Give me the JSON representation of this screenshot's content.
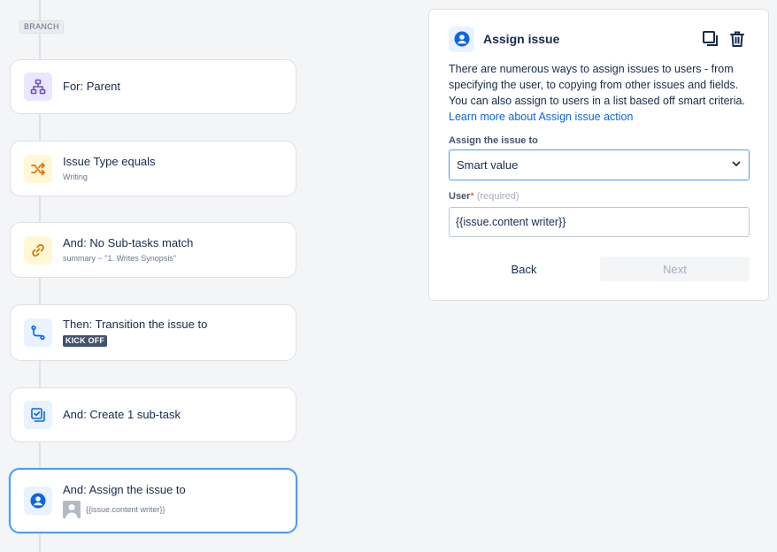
{
  "branch_label": "BRANCH",
  "steps": [
    {
      "title": "For: Parent",
      "icon": "hierarchy-icon"
    },
    {
      "title": "Issue Type equals",
      "subtitle": "Writing",
      "icon": "shuffle-icon"
    },
    {
      "title": "And: No Sub-tasks match",
      "subtitle": "summary ~ \"1. Writes Synopsis\"",
      "icon": "link-icon"
    },
    {
      "title": "Then: Transition the issue to",
      "status": "KICK OFF",
      "icon": "transition-icon"
    },
    {
      "title": "And: Create 1 sub-task",
      "icon": "subtask-icon"
    },
    {
      "title": "And: Assign the issue to",
      "subtitle": "{{issue.content writer}}",
      "icon": "user-icon"
    }
  ],
  "panel": {
    "title": "Assign issue",
    "description": "There are numerous ways to assign issues to users - from specifying the user, to copying from other issues and fields. You can also assign to users in a list based off smart criteria.",
    "learn_more": "Learn more about Assign issue action",
    "assign_label": "Assign the issue to",
    "assign_value": "Smart value",
    "user_label": "User",
    "user_required_mark": "*",
    "user_hint": "(required)",
    "user_value": "{{issue.content writer}}",
    "back_label": "Back",
    "next_label": "Next"
  },
  "colors": {
    "accent": "#0c66e4",
    "selected_border": "#4c9aff",
    "status_lozenge": "#42526e"
  }
}
